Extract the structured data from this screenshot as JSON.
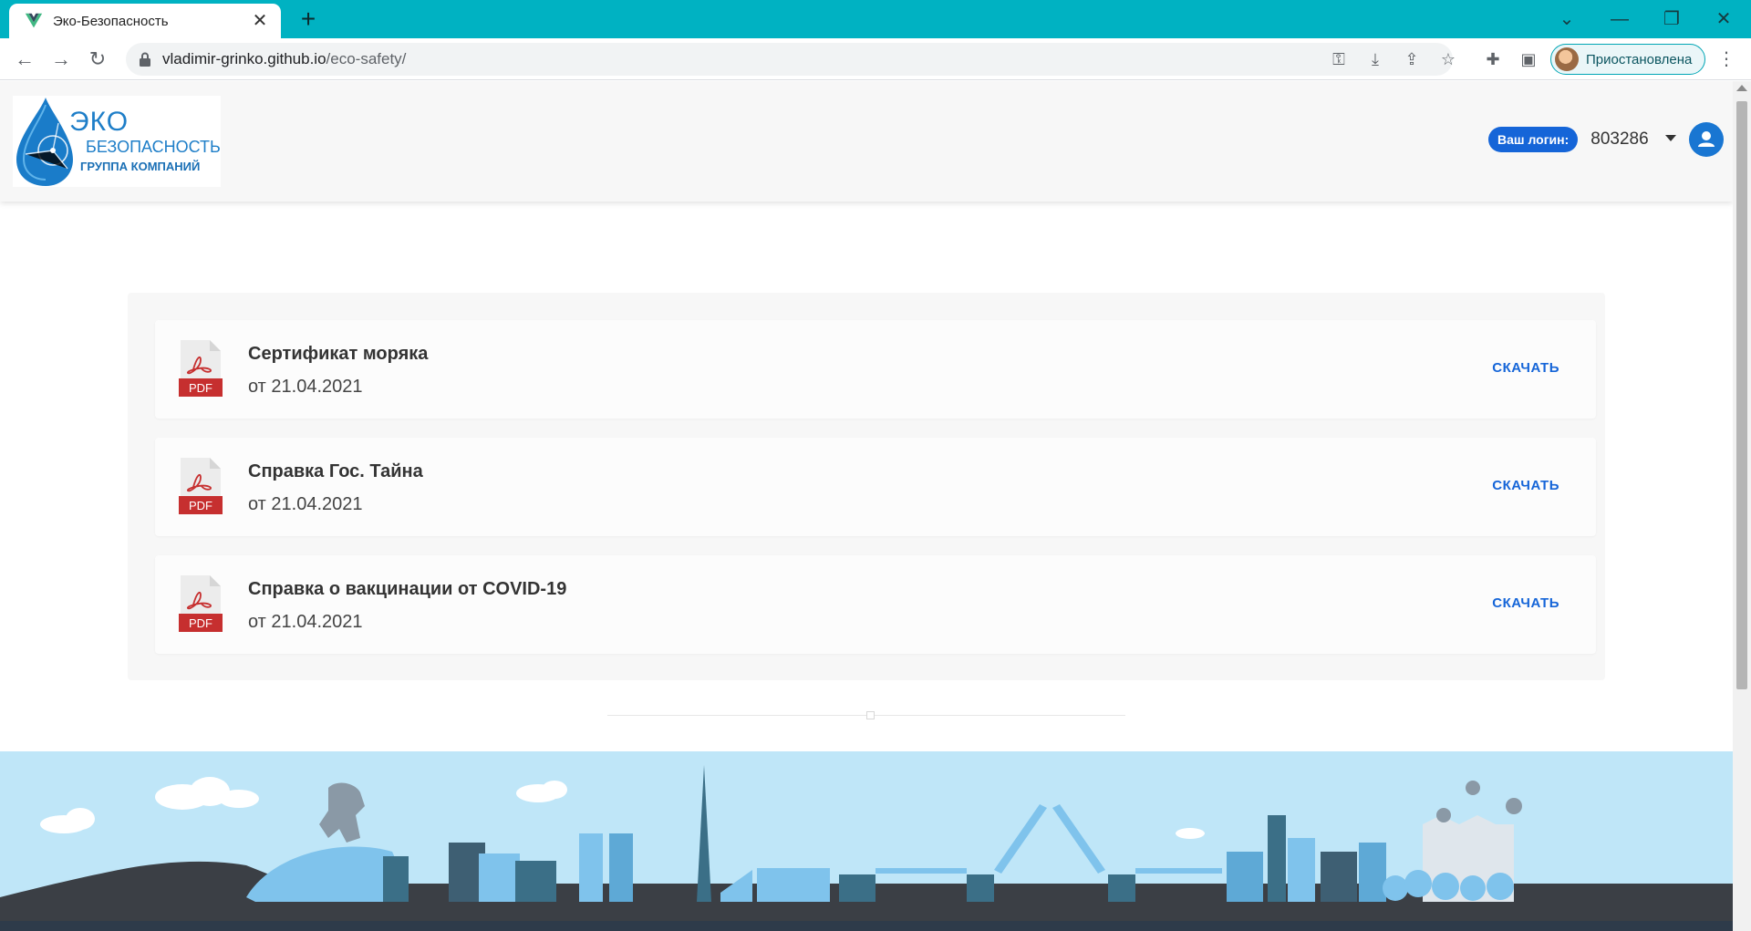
{
  "browser": {
    "tab_title": "Эко-Безопасность",
    "url_host": "vladimir-grinko.github.io",
    "url_path": "/eco-safety/",
    "profile_label": "Приостановлена"
  },
  "header": {
    "logo": {
      "line1": "ЭКО",
      "line2": "БЕЗОПАСНОСТЬ",
      "line3": "ГРУППА КОМПАНИЙ"
    },
    "login_badge": "Ваш логин:",
    "login_value": "803286"
  },
  "documents": [
    {
      "title": "Сертификат моряка",
      "date": "от 21.04.2021",
      "file_type": "PDF",
      "action": "СКАЧАТЬ"
    },
    {
      "title": "Справка Гос. Тайна",
      "date": "от 21.04.2021",
      "file_type": "PDF",
      "action": "СКАЧАТЬ"
    },
    {
      "title": "Справка о вакцинации от COVID-19",
      "date": "от 21.04.2021",
      "file_type": "PDF",
      "action": "СКАЧАТЬ"
    }
  ],
  "colors": {
    "chrome_tabbar": "#00b2c2",
    "accent": "#1565d8",
    "pdf_red": "#c62f2f",
    "sky": "#bfe6f8"
  }
}
